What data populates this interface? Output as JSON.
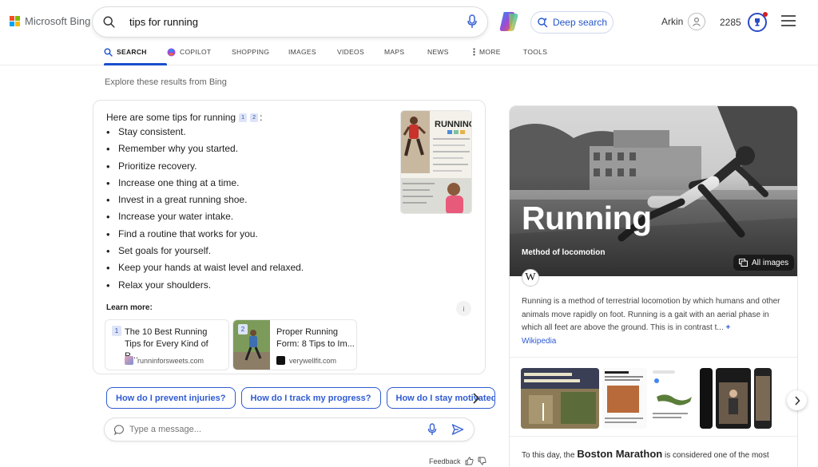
{
  "header": {
    "logo_text": "Microsoft Bing",
    "search_value": "tips for running",
    "deep_search_label": "Deep search",
    "user_name": "Arkin",
    "points": "2285"
  },
  "tabs": [
    {
      "label": "SEARCH",
      "icon": "search-icon"
    },
    {
      "label": "COPILOT",
      "icon": "copilot-icon"
    },
    {
      "label": "SHOPPING"
    },
    {
      "label": "IMAGES"
    },
    {
      "label": "VIDEOS"
    },
    {
      "label": "MAPS"
    },
    {
      "label": "NEWS"
    },
    {
      "label": "MORE",
      "icon": "more-vertical-icon"
    },
    {
      "label": "TOOLS"
    }
  ],
  "explore_text": "Explore these results from Bing",
  "answer": {
    "title": "Here are some tips for running",
    "citations": [
      "1",
      "2"
    ],
    "title_suffix": ":",
    "tips": [
      "Stay consistent.",
      "Remember why you started.",
      "Prioritize recovery.",
      "Increase one thing at a time.",
      "Invest in a great running shoe.",
      "Increase your water intake.",
      "Find a routine that works for you.",
      "Set goals for yourself.",
      "Keep your hands at waist level and relaxed.",
      "Relax your shoulders."
    ],
    "infographic_title": "RUNNING",
    "learn_more": "Learn more:",
    "info_glyph": "i",
    "sources": [
      {
        "num": "1",
        "title": "The 10 Best Running Tips for Every Kind of R...",
        "site": "runninforsweets.com"
      },
      {
        "num": "2",
        "title": "Proper Running Form: 8 Tips to Im...",
        "site": "verywellfit.com"
      }
    ]
  },
  "suggestions": [
    "How do I prevent injuries?",
    "How do I track my progress?",
    "How do I stay motivated?"
  ],
  "message_placeholder": "Type a message...",
  "feedback_label": "Feedback",
  "knowledge_panel": {
    "title": "Running",
    "subtitle": "Method of locomotion",
    "all_images_label": "All images",
    "wiki_glyph": "W",
    "description": "Running is a method of terrestrial locomotion by which humans and other animals move rapidly on foot. Running is a gait with an aerial phase in which all feet are above the ground. This is in contrast t...",
    "more_glyph": "+",
    "source_link": "Wikipedia",
    "fact_prefix": "To this day, the",
    "fact_highlight": "Boston Marathon",
    "fact_suffix": "is considered one of the most"
  },
  "colors": {
    "accent": "#2f5bd3",
    "ms_red": "#f25022",
    "ms_green": "#7fba00",
    "ms_blue": "#00a4ef",
    "ms_yellow": "#ffb900"
  }
}
